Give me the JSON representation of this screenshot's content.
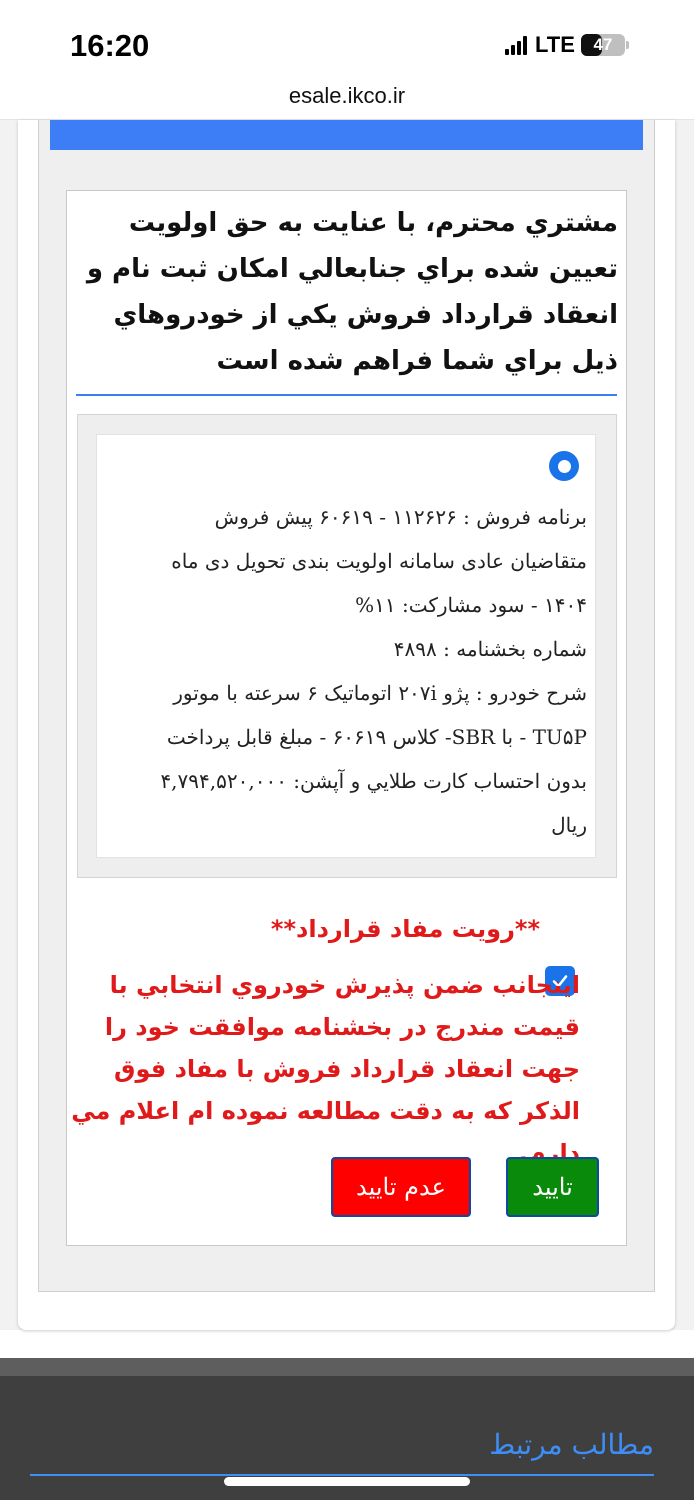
{
  "status_bar": {
    "time": "16:20",
    "network": "LTE",
    "battery_level": "47"
  },
  "browser": {
    "url": "esale.ikco.ir"
  },
  "intro": {
    "message": "مشتري محترم، با عنايت به حق اولويت تعيين شده براي جنابعالي امكان ثبت نام و انعقاد قرارداد فروش يكي از خودروهاي ذيل براي شما فراهم شده است"
  },
  "option": {
    "selected": true,
    "lines": [
      "برنامه فروش : ۱۱۲۶۲۶ - ۶۰۶۱۹ پیش فروش",
      "متقاضیان عادی سامانه اولویت بندی تحویل دی ماه",
      "۱۴۰۴ - سود مشارکت: ۱۱%",
      "شماره بخشنامه : ۴۸۹۸",
      "شرح خودرو : پژو ۲۰۷i اتوماتیک ۶ سرعته با موتور",
      "TU۵P - با SBR- کلاس ۶۰۶۱۹ - مبلغ قابل پرداخت",
      "بدون احتساب کارت طلايي و آپشن: ۴,۷۹۴,۵۲۰,۰۰۰",
      "ريال"
    ]
  },
  "contract": {
    "title": "**رویت مفاد قرارداد**",
    "agree_checked": true,
    "agree_text": "اينجانب ضمن پذيرش خودروي انتخابي با قيمت مندرج در بخشنامه موافقت خود را جهت انعقاد قرارداد فروش با مفاد فوق الذكر كه به دقت مطالعه نموده ام اعلام مي دارم."
  },
  "buttons": {
    "confirm_label": "تایید",
    "reject_label": "عدم تایید"
  },
  "footer": {
    "related_heading": "مطالب مرتبط"
  },
  "colors": {
    "accent_blue": "#3d7ef7",
    "confirm_green": "#0a8a0a",
    "reject_red": "#ff0000",
    "warning_text_red": "#e01a1a"
  }
}
